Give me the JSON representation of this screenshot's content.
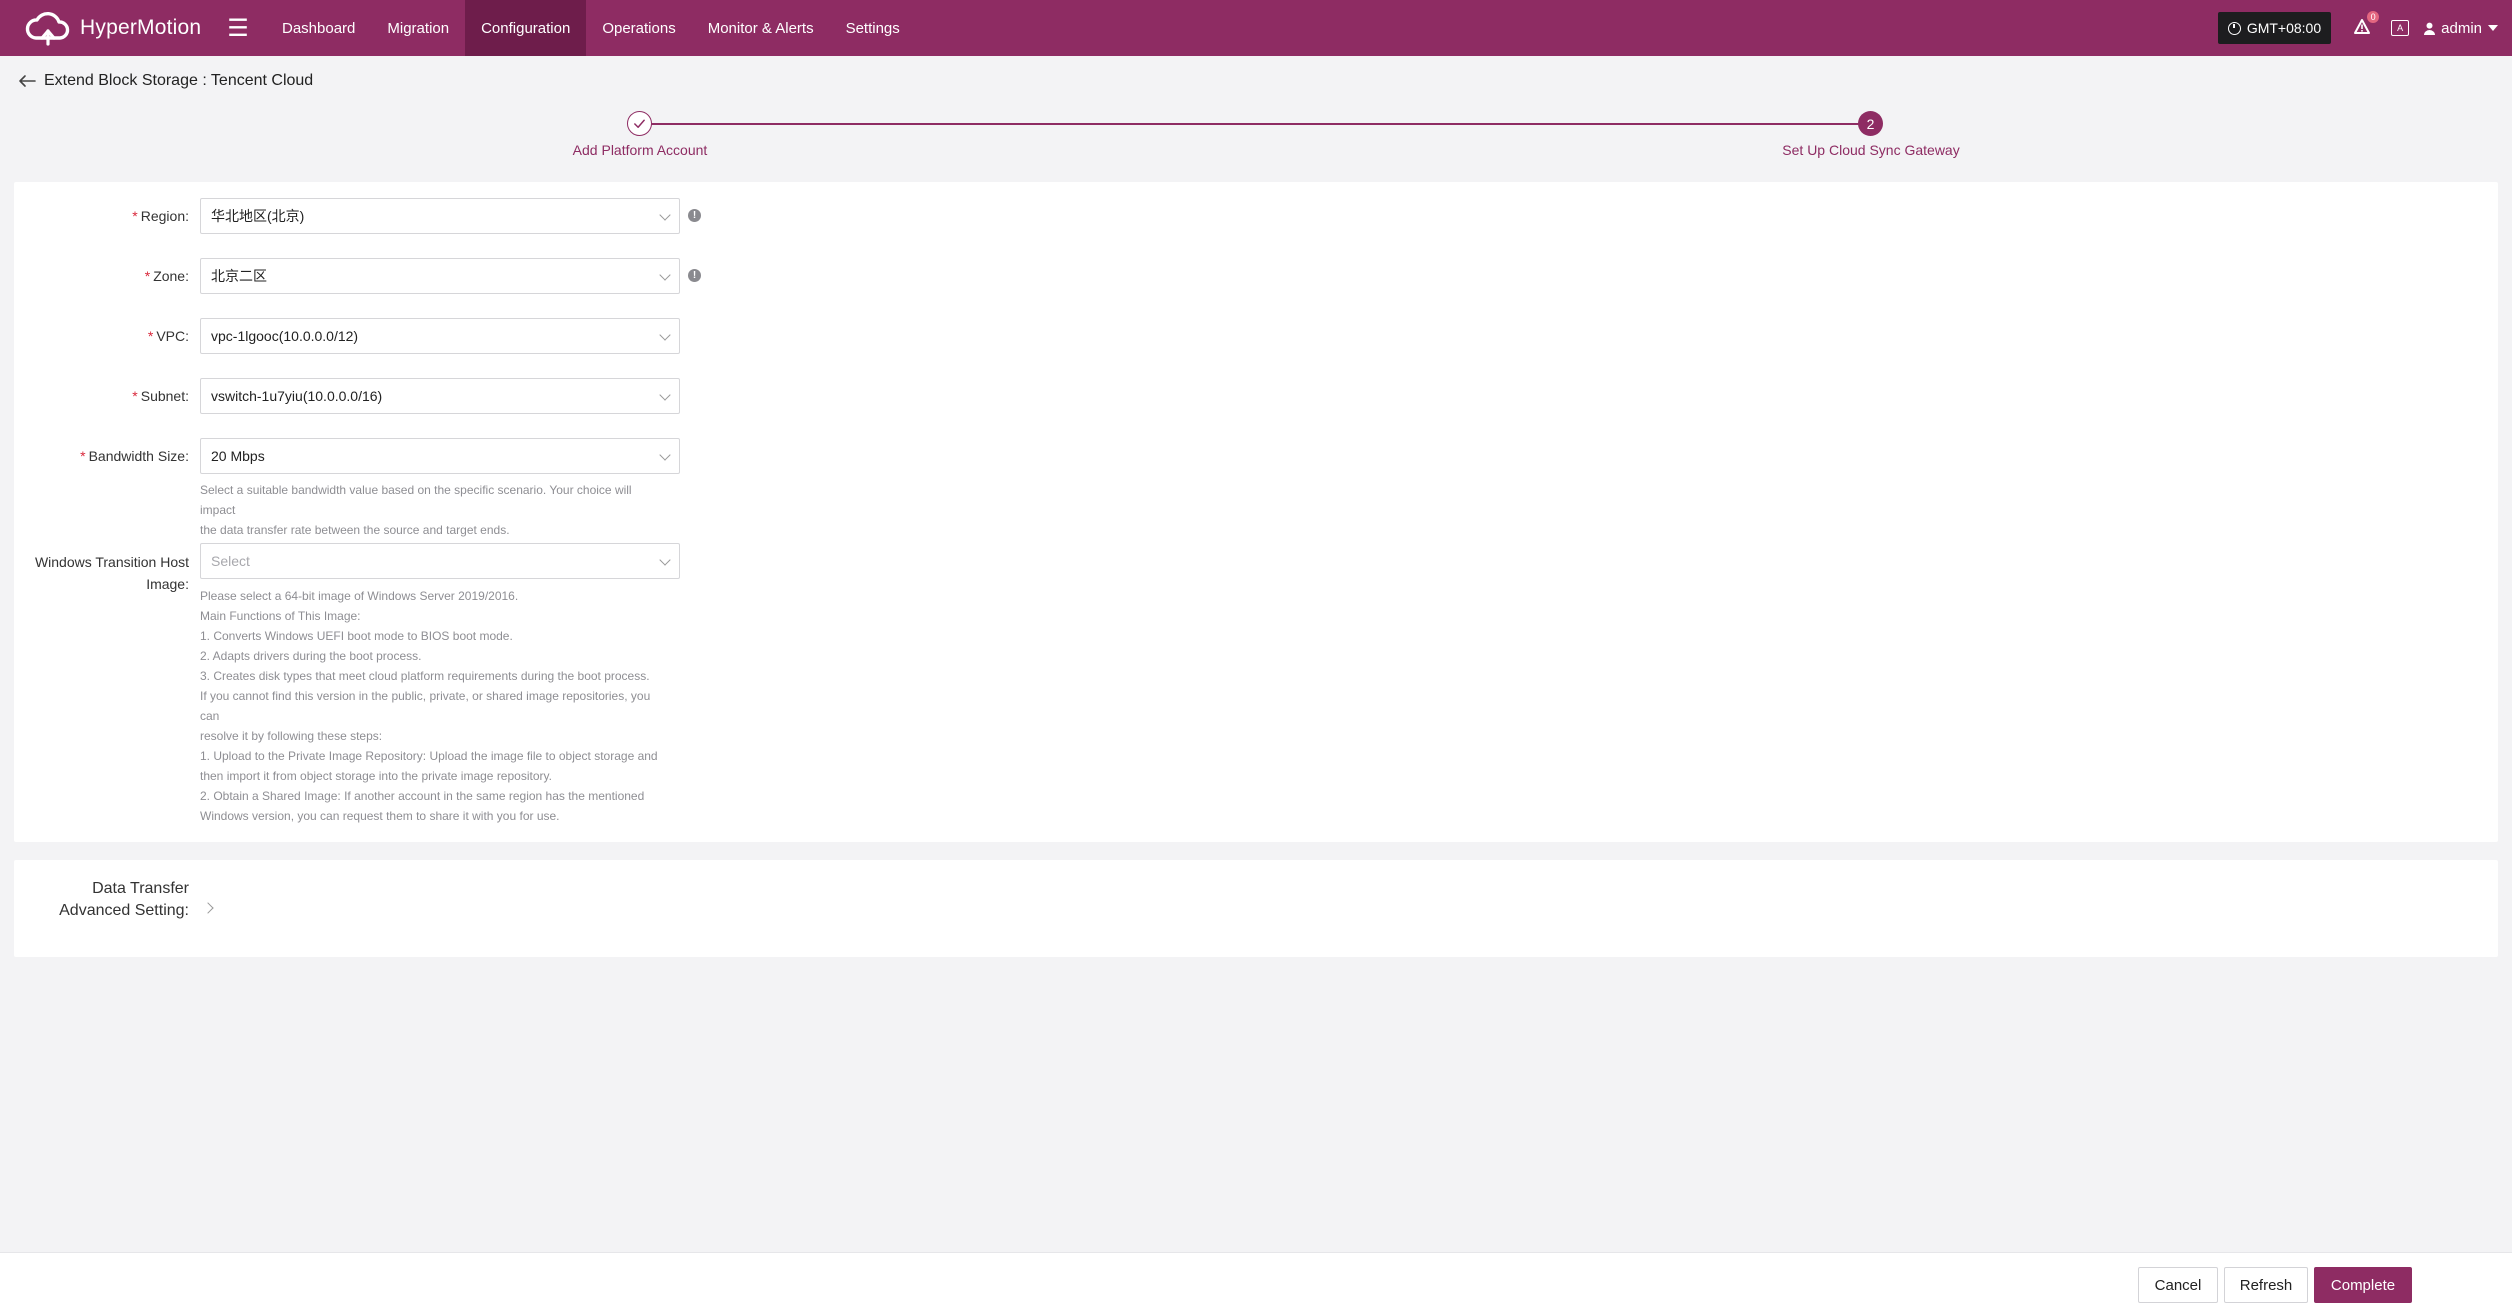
{
  "app": {
    "brand": "HyperMotion",
    "nav": [
      {
        "label": "Dashboard",
        "active": false
      },
      {
        "label": "Migration",
        "active": false
      },
      {
        "label": "Configuration",
        "active": true
      },
      {
        "label": "Operations",
        "active": false
      },
      {
        "label": "Monitor & Alerts",
        "active": false
      },
      {
        "label": "Settings",
        "active": false
      }
    ],
    "timezone": "GMT+08:00",
    "alert_count": "0",
    "lang_glyph": "A",
    "user": "admin",
    "accent_color": "#8e2c63"
  },
  "page": {
    "title": "Extend Block Storage : Tencent Cloud"
  },
  "steps": [
    {
      "number": "1",
      "label": "Add Platform Account",
      "state": "done"
    },
    {
      "number": "2",
      "label": "Set Up Cloud Sync Gateway",
      "state": "current"
    }
  ],
  "form": {
    "region": {
      "label": "Region:",
      "value": "华北地区(北京)"
    },
    "zone": {
      "label": "Zone:",
      "value": "北京二区"
    },
    "vpc": {
      "label": "VPC:",
      "value": "vpc-1lgooc(10.0.0.0/12)"
    },
    "subnet": {
      "label": "Subnet:",
      "value": "vswitch-1u7yiu(10.0.0.0/16)"
    },
    "bandwidth": {
      "label": "Bandwidth Size:",
      "value": "20 Mbps",
      "help": [
        "Select a suitable bandwidth value based on the specific scenario. Your choice will impact",
        "the data transfer rate between the source and target ends."
      ]
    },
    "windows_image": {
      "label_line1": "Windows Transition Host",
      "label_line2": "Image:",
      "placeholder": "Select",
      "help": [
        "Please select a 64-bit image of Windows Server 2019/2016.",
        "Main Functions of This Image:",
        "1. Converts Windows UEFI boot mode to BIOS boot mode.",
        "2. Adapts drivers during the boot process.",
        "3. Creates disk types that meet cloud platform requirements during the boot process.",
        "If you cannot find this version in the public, private, or shared image repositories, you can",
        "resolve it by following these steps:",
        "1. Upload to the Private Image Repository: Upload the image file to object storage and",
        "then import it from object storage into the private image repository.",
        "2. Obtain a Shared Image: If another account in the same region has the mentioned",
        "Windows version, you can request them to share it with you for use."
      ]
    }
  },
  "advanced": {
    "label_line1": "Data Transfer",
    "label_line2": "Advanced Setting:"
  },
  "footer": {
    "cancel": "Cancel",
    "refresh": "Refresh",
    "complete": "Complete"
  }
}
